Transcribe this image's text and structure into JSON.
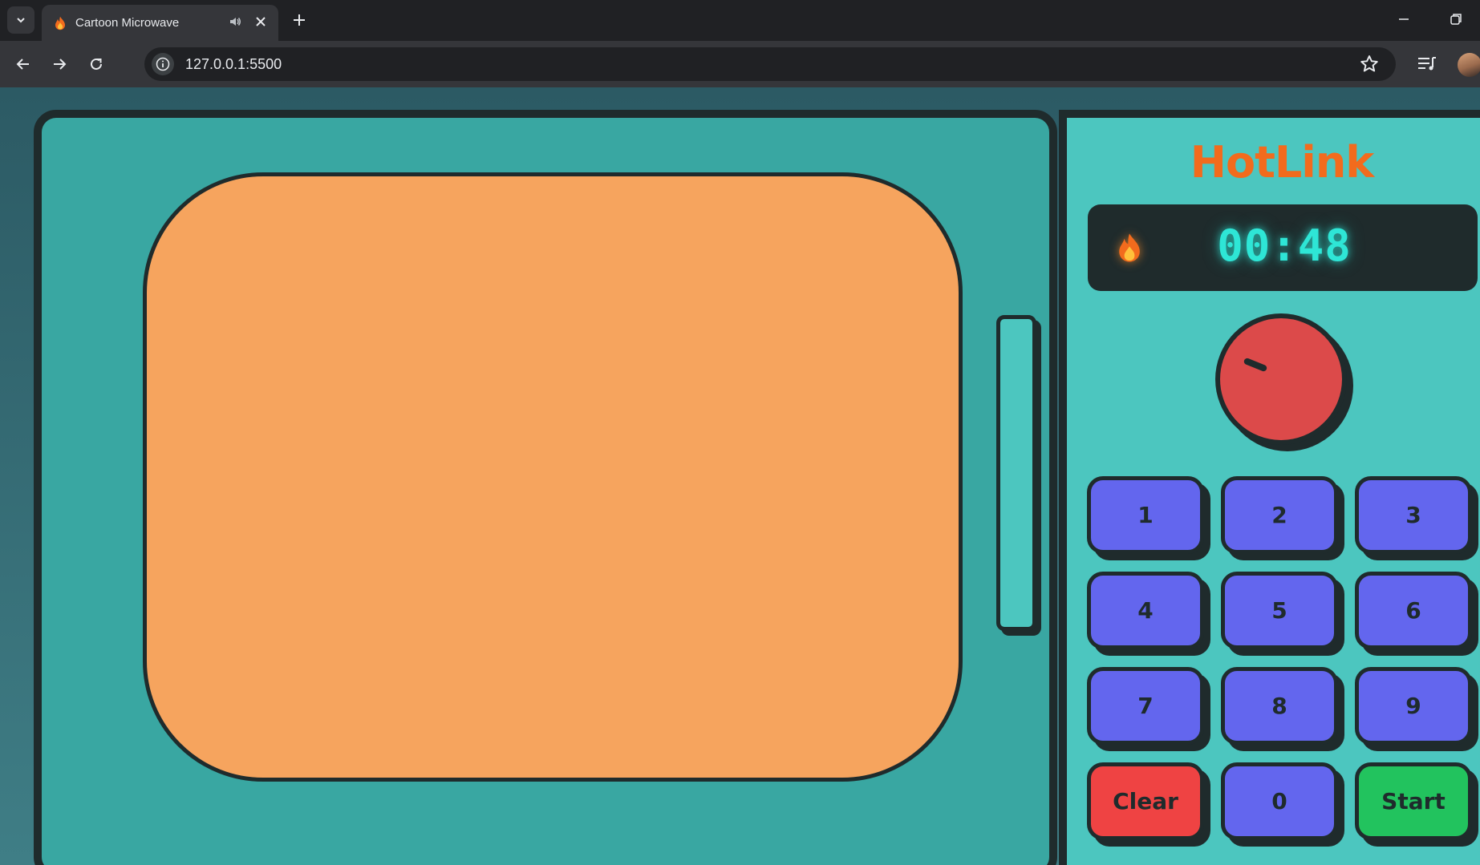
{
  "browser": {
    "tab_title": "Cartoon Microwave",
    "url": "127.0.0.1:5500"
  },
  "icons": {
    "tab_search": "chevron-down-icon",
    "favicon": "flame-icon",
    "tab_audio": "speaker-icon",
    "tab_close": "close-icon",
    "new_tab": "plus-icon",
    "back": "arrow-left-icon",
    "forward": "arrow-right-icon",
    "reload": "reload-icon",
    "site_info": "info-icon",
    "bookmark": "star-icon",
    "media": "media-control-icon",
    "minimize": "minimize-icon",
    "restore": "restore-icon"
  },
  "microwave": {
    "brand": "HotLink",
    "display_time": "00:48",
    "status_icon": "flame-icon",
    "keys": [
      "1",
      "2",
      "3",
      "4",
      "5",
      "6",
      "7",
      "8",
      "9",
      "Clear",
      "0",
      "Start"
    ]
  },
  "colors": {
    "brand": "#f26b1d",
    "door": "#39a7a2",
    "panel": "#4cc6bf",
    "window": "#f6a45e",
    "outline": "#1f2b2c",
    "display_text": "#2ee6d6",
    "dial": "#dc4a4a",
    "key": "#6366ee",
    "clear_key": "#ef4343",
    "start_key": "#22c35e"
  }
}
